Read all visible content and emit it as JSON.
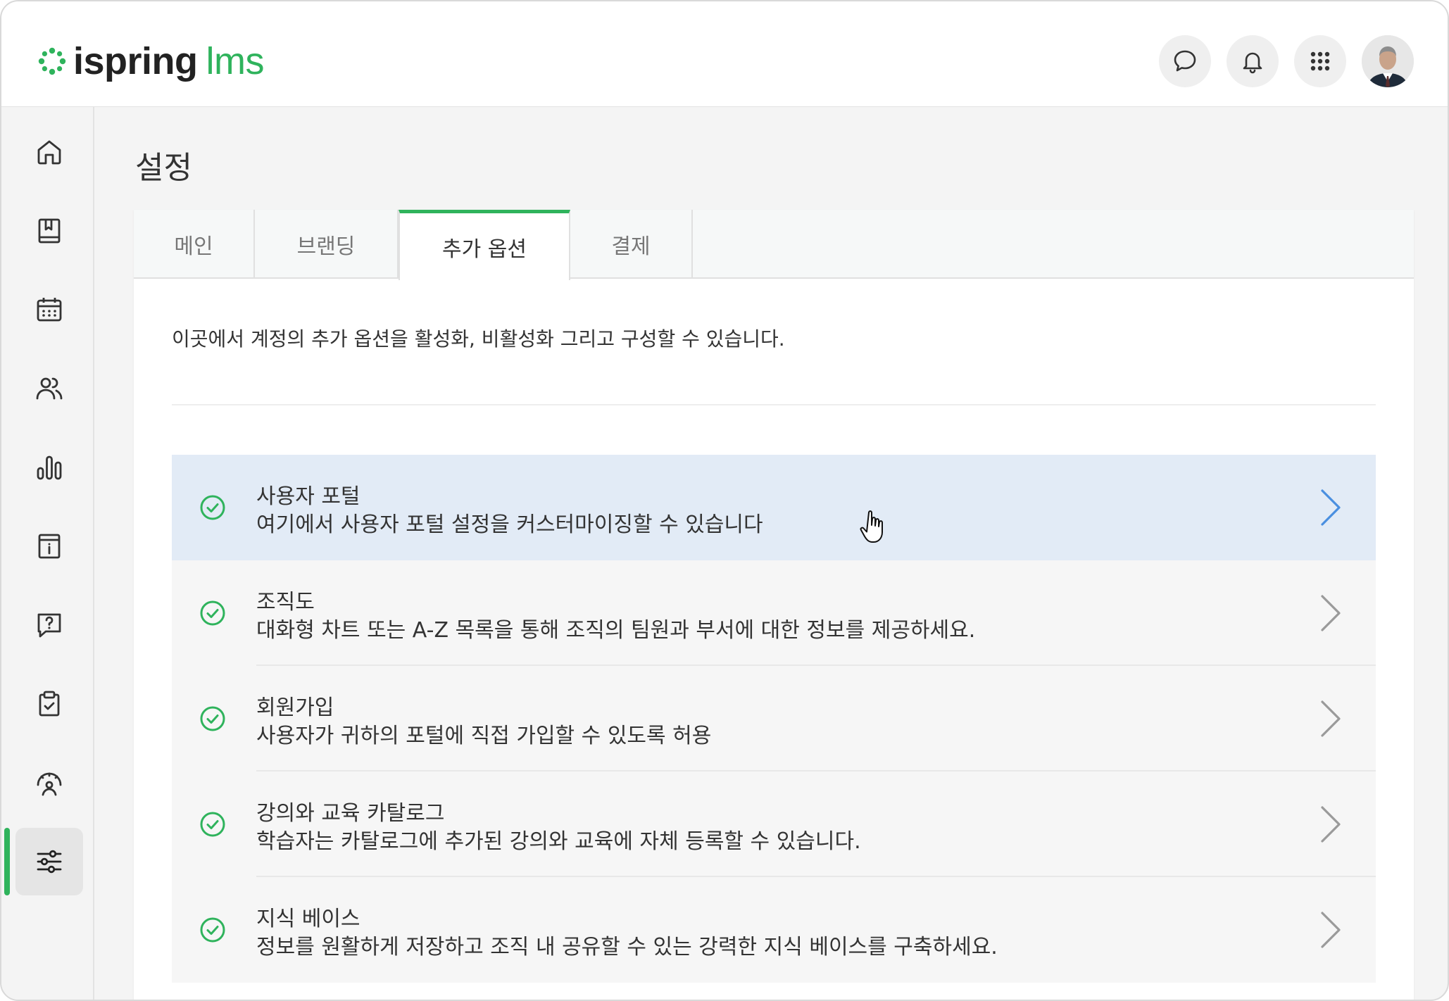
{
  "brand": {
    "name_bold": "ispring",
    "name_light": "lms",
    "accent": "#2fb35c"
  },
  "header": {
    "actions": [
      {
        "icon": "chat-icon"
      },
      {
        "icon": "bell-icon"
      },
      {
        "icon": "apps-grid-icon"
      }
    ],
    "avatar": "user-avatar"
  },
  "sidebar": {
    "items": [
      {
        "icon": "home-icon"
      },
      {
        "icon": "book-icon"
      },
      {
        "icon": "calendar-icon"
      },
      {
        "icon": "users-icon"
      },
      {
        "icon": "bar-chart-icon"
      },
      {
        "icon": "info-board-icon"
      },
      {
        "icon": "question-bubble-icon"
      },
      {
        "icon": "clipboard-check-icon"
      },
      {
        "icon": "gauge-user-icon"
      },
      {
        "icon": "settings-sliders-icon",
        "active": true
      }
    ]
  },
  "page": {
    "title": "설정"
  },
  "tabs": [
    {
      "label": "메인"
    },
    {
      "label": "브랜딩"
    },
    {
      "label": "추가 옵션",
      "active": true
    },
    {
      "label": "결제"
    }
  ],
  "intro": "이곳에서 계정의 추가 옵션을 활성화, 비활성화 그리고 구성할 수 있습니다.",
  "options": [
    {
      "title": "사용자 포털",
      "description": "여기에서 사용자 포털 설정을 커스터마이징할 수 있습니다",
      "enabled": true,
      "hovered": true
    },
    {
      "title": "조직도",
      "description": "대화형 차트 또는 A-Z 목록을 통해 조직의 팀원과 부서에 대한 정보를 제공하세요.",
      "enabled": true
    },
    {
      "title": "회원가입",
      "description": "사용자가 귀하의 포털에 직접 가입할 수 있도록 허용",
      "enabled": true
    },
    {
      "title": "강의와 교육 카탈로그",
      "description": "학습자는 카탈로그에 추가된 강의와 교육에 자체 등록할 수 있습니다.",
      "enabled": true
    },
    {
      "title": "지식 베이스",
      "description": "정보를 원활하게 저장하고 조직 내 공유할 수 있는 강력한 지식 베이스를 구축하세요.",
      "enabled": true
    }
  ]
}
